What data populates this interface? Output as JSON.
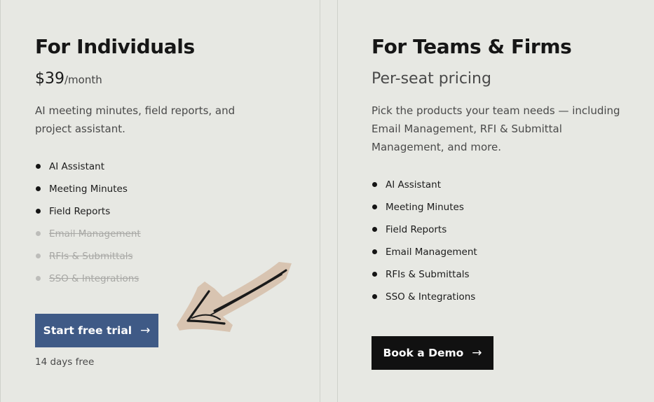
{
  "individuals": {
    "title": "For Individuals",
    "price": "$39",
    "period": "/month",
    "description": "AI meeting minutes, field reports, and project assistant.",
    "features": [
      {
        "label": "AI Assistant",
        "included": true
      },
      {
        "label": "Meeting Minutes",
        "included": true
      },
      {
        "label": "Field Reports",
        "included": true
      },
      {
        "label": "Email Management",
        "included": false
      },
      {
        "label": "RFIs & Submittals",
        "included": false
      },
      {
        "label": "SSO & Integrations",
        "included": false
      }
    ],
    "cta_label": "Start free trial",
    "cta_arrow": "→",
    "note": "14 days free"
  },
  "teams": {
    "title": "For Teams & Firms",
    "subtitle": "Per-seat pricing",
    "description": "Pick the products your team needs — including Email Management, RFI & Submittal Management, and more.",
    "features": [
      {
        "label": "AI Assistant",
        "included": true
      },
      {
        "label": "Meeting Minutes",
        "included": true
      },
      {
        "label": "Field Reports",
        "included": true
      },
      {
        "label": "Email Management",
        "included": true
      },
      {
        "label": "RFIs & Submittals",
        "included": true
      },
      {
        "label": "SSO & Integrations",
        "included": true
      }
    ],
    "cta_label": "Book a Demo",
    "cta_arrow": "→"
  },
  "colors": {
    "background": "#e7e8e3",
    "trial_button": "#3f5a86",
    "demo_button": "#111111",
    "doodle_highlight": "#d8c4b1"
  },
  "decoration": {
    "doodle_icon": "hand-drawn-arrow-icon"
  }
}
